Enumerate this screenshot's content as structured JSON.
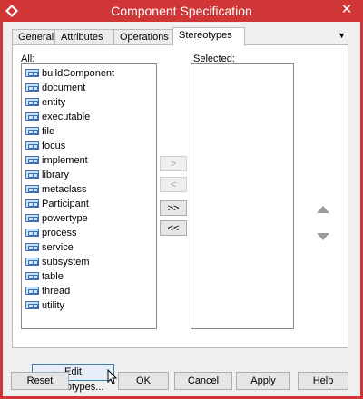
{
  "window": {
    "title": "Component Specification",
    "close_glyph": "✕",
    "accent_color": "#d13636"
  },
  "tabs": {
    "items": [
      {
        "label": "General"
      },
      {
        "label": "Attributes"
      },
      {
        "label": "Operations"
      },
      {
        "label": "Stereotypes"
      }
    ],
    "active": "Stereotypes",
    "menu_glyph": "▼"
  },
  "stereotypes": {
    "all_label": "All:",
    "selected_label": "Selected:",
    "all_items": [
      "buildComponent",
      "document",
      "entity",
      "executable",
      "file",
      "focus",
      "implement",
      "library",
      "metaclass",
      "Participant",
      "powertype",
      "process",
      "service",
      "subsystem",
      "table",
      "thread",
      "utility"
    ],
    "selected_items": [],
    "icon": "stereotype-icon",
    "buttons": {
      "add": ">",
      "remove": "<",
      "add_all": ">>",
      "remove_all": "<<"
    },
    "edit_button": "Edit Stereotypes..."
  },
  "footer": {
    "reset": "Reset",
    "ok": "OK",
    "cancel": "Cancel",
    "apply": "Apply",
    "help": "Help"
  }
}
